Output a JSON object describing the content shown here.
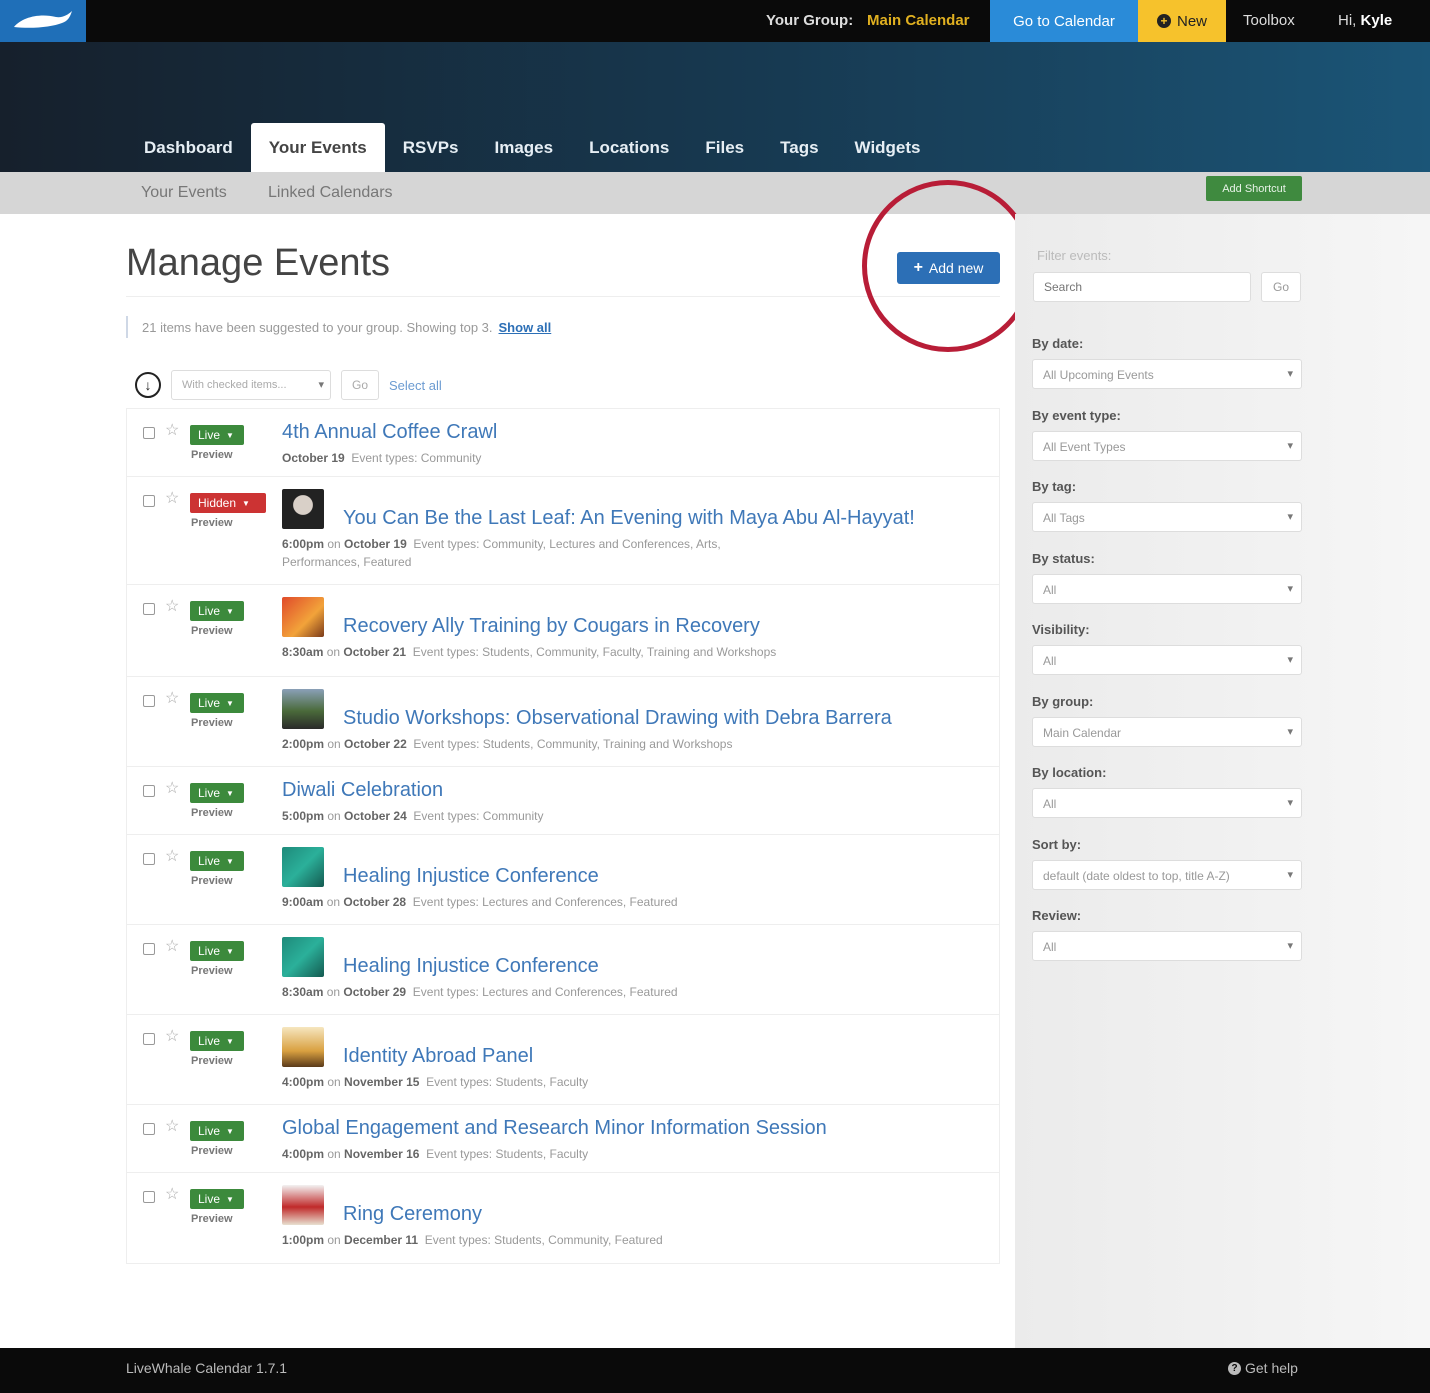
{
  "topbar": {
    "group_label": "Your Group:",
    "group_name": "Main Calendar",
    "goto_calendar": "Go to Calendar",
    "new_label": "New",
    "toolbox": "Toolbox",
    "greeting": "Hi,",
    "user": "Kyle"
  },
  "tabs": [
    {
      "label": "Dashboard"
    },
    {
      "label": "Your Events",
      "active": true
    },
    {
      "label": "RSVPs"
    },
    {
      "label": "Images"
    },
    {
      "label": "Locations"
    },
    {
      "label": "Files"
    },
    {
      "label": "Tags"
    },
    {
      "label": "Widgets"
    }
  ],
  "subnav": {
    "items": [
      "Your Events",
      "Linked Calendars"
    ],
    "add_shortcut": "Add Shortcut"
  },
  "main": {
    "title": "Manage Events",
    "add_new": "Add new",
    "notice_text": "21 items have been suggested to your group. Showing top 3.",
    "notice_link": "Show all",
    "bulk_select": "With checked items...",
    "bulk_go": "Go",
    "select_all": "Select all",
    "preview_label": "Preview",
    "events": [
      {
        "title": "4th Annual Coffee Crawl",
        "status": "Live",
        "thumb": false,
        "time": "",
        "date": "October 19",
        "types": "Event types: Community"
      },
      {
        "title": "You Can Be the Last Leaf: An Evening with Maya Abu Al-Hayyat!",
        "status": "Hidden",
        "thumb": true,
        "time": "6:00pm",
        "date": "October 19",
        "types": "Event types: Community, Lectures and Conferences, Arts, Performances, Featured"
      },
      {
        "title": "Recovery Ally Training by Cougars in Recovery",
        "status": "Live",
        "thumb": true,
        "time": "8:30am",
        "date": "October 21",
        "types": "Event types: Students, Community, Faculty, Training and Workshops"
      },
      {
        "title": "Studio Workshops: Observational Drawing with Debra Barrera",
        "status": "Live",
        "thumb": true,
        "time": "2:00pm",
        "date": "October 22",
        "types": "Event types: Students, Community, Training and Workshops"
      },
      {
        "title": "Diwali Celebration",
        "status": "Live",
        "thumb": false,
        "time": "5:00pm",
        "date": "October 24",
        "types": "Event types: Community"
      },
      {
        "title": "Healing Injustice Conference",
        "status": "Live",
        "thumb": true,
        "time": "9:00am",
        "date": "October 28",
        "types": "Event types: Lectures and Conferences, Featured"
      },
      {
        "title": "Healing Injustice Conference",
        "status": "Live",
        "thumb": true,
        "time": "8:30am",
        "date": "October 29",
        "types": "Event types: Lectures and Conferences, Featured"
      },
      {
        "title": "Identity Abroad Panel",
        "status": "Live",
        "thumb": true,
        "time": "4:00pm",
        "date": "November 15",
        "types": "Event types: Students, Faculty"
      },
      {
        "title": "Global Engagement and Research Minor Information Session",
        "status": "Live",
        "thumb": false,
        "time": "4:00pm",
        "date": "November 16",
        "types": "Event types: Students, Faculty"
      },
      {
        "title": "Ring Ceremony",
        "status": "Live",
        "thumb": true,
        "time": "1:00pm",
        "date": "December 11",
        "types": "Event types: Students, Community, Featured"
      }
    ]
  },
  "sidebar": {
    "filter_label": "Filter events:",
    "search_placeholder": "Search",
    "go": "Go",
    "filters": [
      {
        "label": "By date:",
        "value": "All Upcoming Events"
      },
      {
        "label": "By event type:",
        "value": "All Event Types"
      },
      {
        "label": "By tag:",
        "value": "All Tags"
      },
      {
        "label": "By status:",
        "value": "All"
      },
      {
        "label": "Visibility:",
        "value": "All"
      },
      {
        "label": "By group:",
        "value": "Main Calendar"
      },
      {
        "label": "By location:",
        "value": "All"
      },
      {
        "label": "Sort by:",
        "value": "default (date oldest to top, title A-Z)"
      },
      {
        "label": "Review:",
        "value": "All"
      }
    ]
  },
  "footer": {
    "version": "LiveWhale Calendar 1.7.1",
    "help": "Get help"
  },
  "colors": {
    "accent_blue": "#2c6fb6",
    "live_green": "#3c8a3c",
    "hidden_red": "#cc3333",
    "highlight": "#b81d37",
    "new_yellow": "#f6c22c"
  }
}
